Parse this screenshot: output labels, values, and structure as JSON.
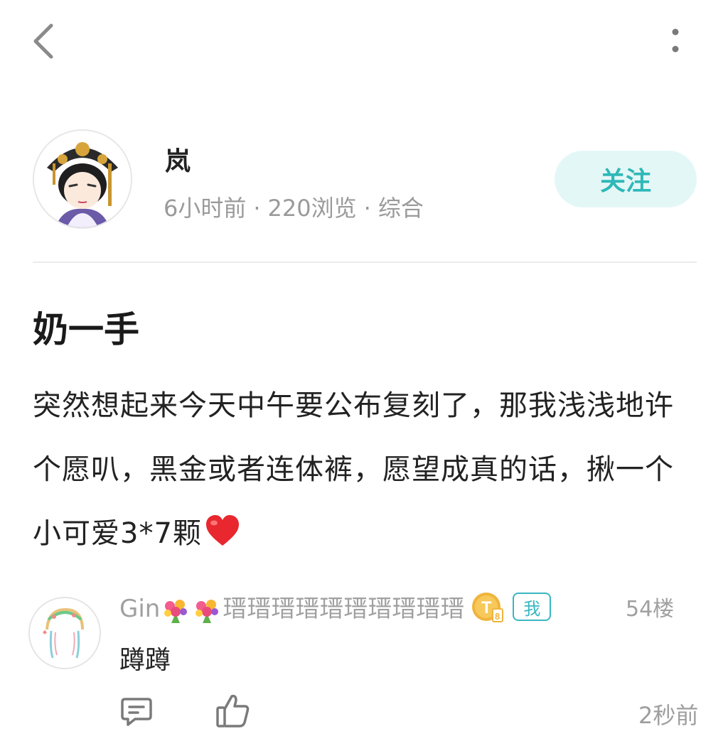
{
  "topbar": {
    "back_icon": "chevron-left-icon",
    "more_icon": "vertical-ellipsis-icon"
  },
  "author": {
    "name": "岚",
    "time_ago": "6小时前",
    "views": "220浏览",
    "category": "综合",
    "separator": "·",
    "follow_label": "关注"
  },
  "post": {
    "title": "奶一手",
    "body": "突然想起来今天中午要公布复刻了，那我浅浅地许个愿叭，黑金或者连体裤，愿望成真的话，揪一个小可爱3*7颗",
    "trailing_icon": "red-heart-icon"
  },
  "comment": {
    "user_prefix": "Gin",
    "user_suffix": "瑨瑨瑨瑨瑨瑨瑨瑨瑨瑨",
    "name_emoji": "bouquet-icon",
    "level_badge_letter": "T",
    "level_badge_number": "8",
    "me_badge": "我",
    "floor": "54楼",
    "text": "蹲蹲",
    "time": "2秒前"
  },
  "colors": {
    "accent": "#2fb8b8",
    "follow_bg": "#e4f7f7",
    "meta_gray": "#9a9a9a",
    "heart": "#e8272f",
    "badge_gold": "#f0b43c"
  }
}
